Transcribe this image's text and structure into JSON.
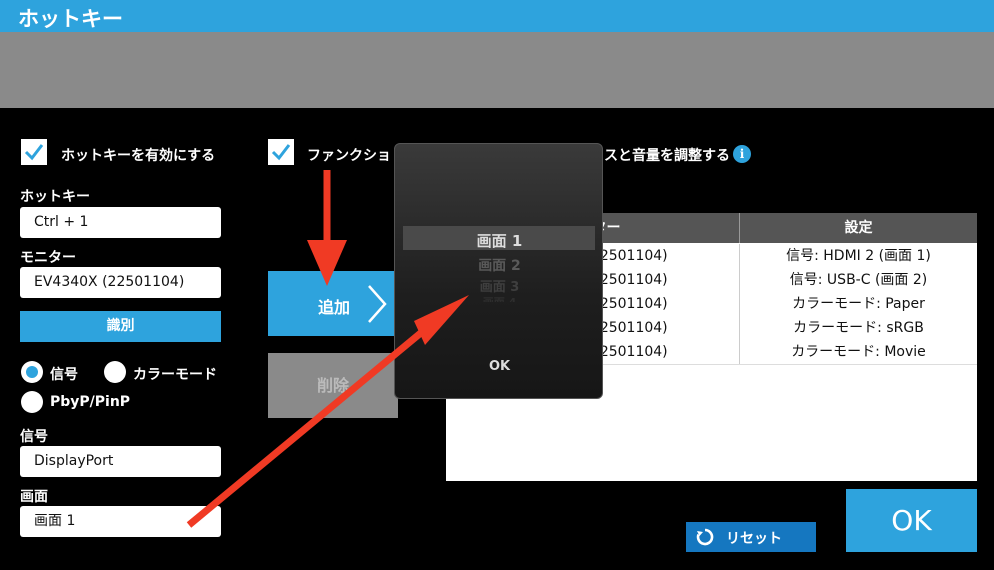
{
  "window": {
    "title": "ホットキー"
  },
  "left": {
    "enable_hotkey_label": "ホットキーを有効にする",
    "hotkey_label": "ホットキー",
    "hotkey_value": "Ctrl + 1",
    "monitor_label": "モニター",
    "monitor_value": "EV4340X (22501104)",
    "identify_button": "識別",
    "radio_signal": "信号",
    "radio_color_mode": "カラーモード",
    "radio_pbyp": "PbyP/PinP",
    "signal_label": "信号",
    "signal_value": "DisplayPort",
    "screen_label": "画面",
    "screen_value": "画面 1"
  },
  "function_row": {
    "label_left": "ファンクショ",
    "label_right": "スと音量を調整する",
    "info_icon": "i"
  },
  "actions": {
    "add_button": "追加",
    "delete_button": "削除"
  },
  "table": {
    "headers": [
      "モニター",
      "設定"
    ],
    "rows": [
      {
        "monitor": "EV4340X (22501104)",
        "setting": "信号: HDMI 2 (画面 1)"
      },
      {
        "monitor": "EV4340X (22501104)",
        "setting": "信号: USB-C (画面 2)"
      },
      {
        "monitor": "EV4340X (22501104)",
        "setting": "カラーモード: Paper"
      },
      {
        "monitor": "EV4340X (22501104)",
        "setting": "カラーモード: sRGB"
      },
      {
        "monitor": "EV4340X (22501104)",
        "setting": "カラーモード: Movie"
      }
    ]
  },
  "popup": {
    "options": [
      "画面 1",
      "画面 2",
      "画面 3",
      "画面 4"
    ],
    "selected": "画面 1",
    "ok_label": "OK"
  },
  "footer": {
    "reset_button": "リセット",
    "ok_button": "OK"
  },
  "colors": {
    "accent": "#2ea3dd",
    "annotation_arrow": "#f03a24",
    "header_bg": "#555555"
  }
}
